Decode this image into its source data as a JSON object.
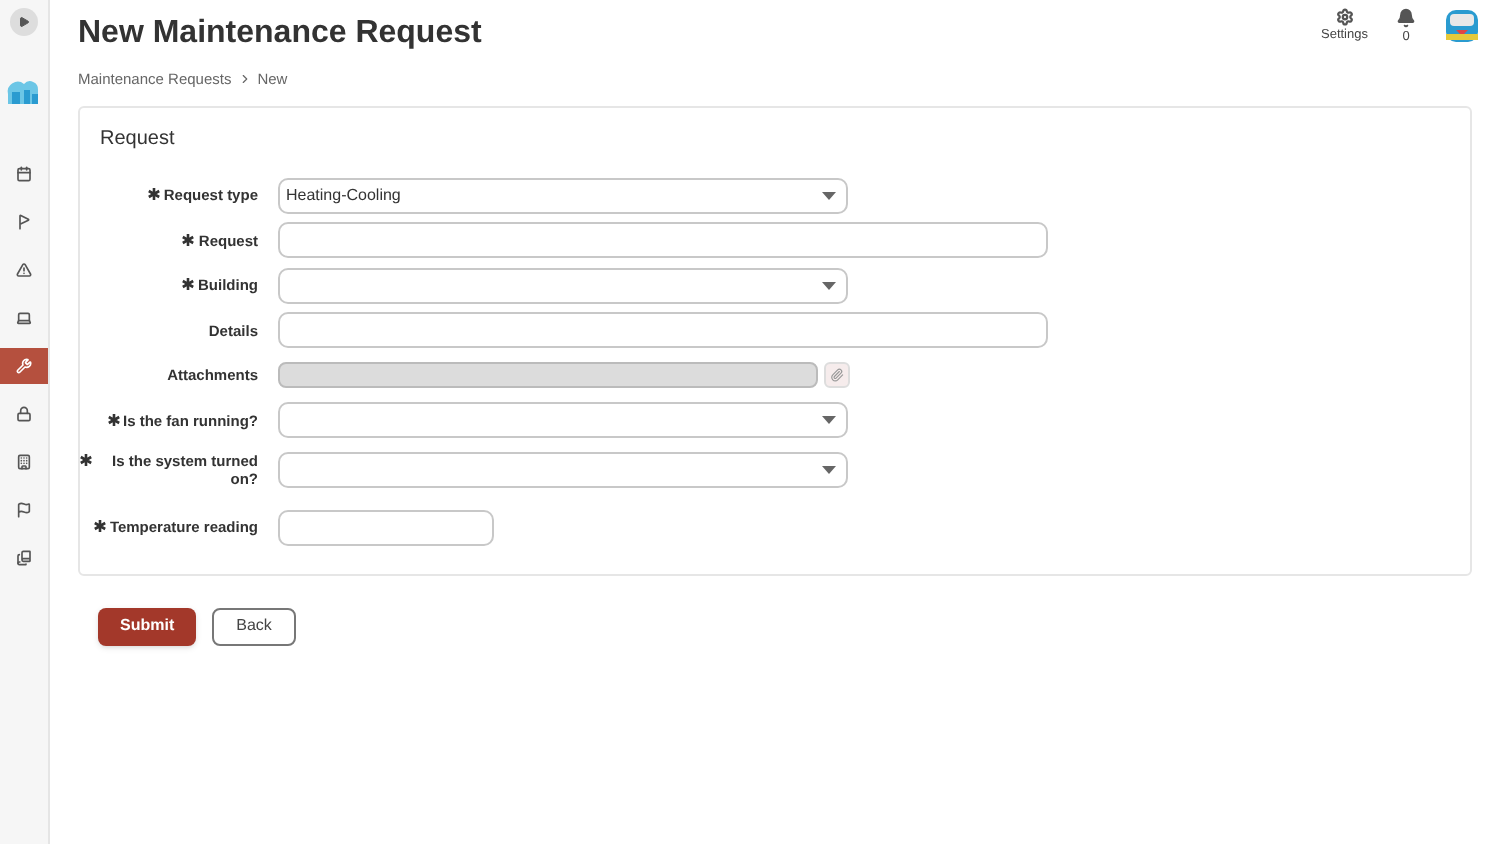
{
  "header": {
    "title": "New Maintenance Request",
    "settings_label": "Settings",
    "notification_count": "0"
  },
  "breadcrumb": [
    "Maintenance Requests",
    "New"
  ],
  "sidebar": {
    "items": [
      {
        "selected": false
      },
      {
        "selected": false
      },
      {
        "selected": false
      },
      {
        "selected": false
      },
      {
        "selected": true
      },
      {
        "selected": false
      },
      {
        "selected": false
      },
      {
        "selected": false
      },
      {
        "selected": false
      }
    ]
  },
  "form": {
    "title": "Request",
    "fields": [
      {
        "label": "Request type",
        "required": true,
        "kind": "select",
        "value": "Heating-Cooling"
      },
      {
        "label": "Request",
        "required": true,
        "kind": "text"
      },
      {
        "label": "Building",
        "required": true,
        "kind": "select"
      },
      {
        "label": "Details",
        "required": false,
        "kind": "text"
      },
      {
        "label": "Attachments",
        "required": false,
        "kind": "attachment"
      },
      {
        "label": "Is the fan running?",
        "required": true,
        "kind": "select"
      },
      {
        "label": "Is the system turned on?",
        "required": true,
        "kind": "select"
      },
      {
        "label": "Temperature reading",
        "required": true,
        "kind": "short"
      }
    ]
  },
  "buttons": [
    {
      "label": "Submit",
      "kind": "primary"
    },
    {
      "label": "Back",
      "kind": "secondary"
    }
  ]
}
